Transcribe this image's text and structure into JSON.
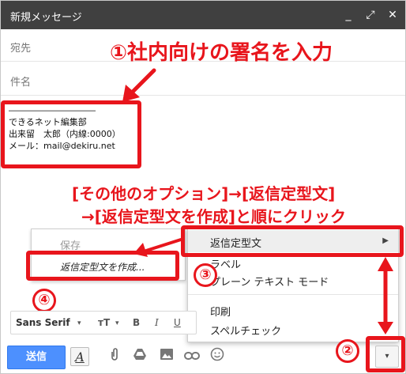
{
  "window": {
    "title": "新規メッセージ",
    "controls": {
      "minimize": "_",
      "expand": "⤢",
      "close": "✕"
    }
  },
  "fields": {
    "to_label": "宛先",
    "subject_label": "件名"
  },
  "signature": {
    "line1": "――――――――――",
    "line2": "できるネット編集部",
    "line3": "出来留　太郎（内線:0000）",
    "line4": "メール：mail@dekiru.net"
  },
  "annotations": {
    "step1": "①社内向けの署名を入力",
    "instruction_line1": "[その他のオプション]→[返信定型文]",
    "instruction_line2": "→[返信定型文を作成]と順にクリック",
    "step2": "②",
    "step3": "③",
    "step4": "④",
    "accent_color": "#e8151c"
  },
  "submenu": {
    "save": "保存",
    "create": "返信定型文を作成..."
  },
  "menu": {
    "canned_responses": "返信定型文",
    "label": "ラベル",
    "plain_text": "プレーン テキスト モード",
    "print": "印刷",
    "spellcheck": "スペルチェック",
    "submenu_arrow": "▶"
  },
  "format_bar": {
    "font": "Sans Serif",
    "font_caret": "▾",
    "size": "ᴛT",
    "size_caret": "▾",
    "bold": "B",
    "italic": "I",
    "underline": "U"
  },
  "toolbar": {
    "send": "送信",
    "format_icon": "A",
    "attach_icon": "paperclip-icon",
    "drive_icon": "drive-icon",
    "photo_icon": "photo-icon",
    "link_icon": "link-icon",
    "emoji_icon": "emoji-icon",
    "more_caret": "▾",
    "send_color": "#4d90fe"
  }
}
